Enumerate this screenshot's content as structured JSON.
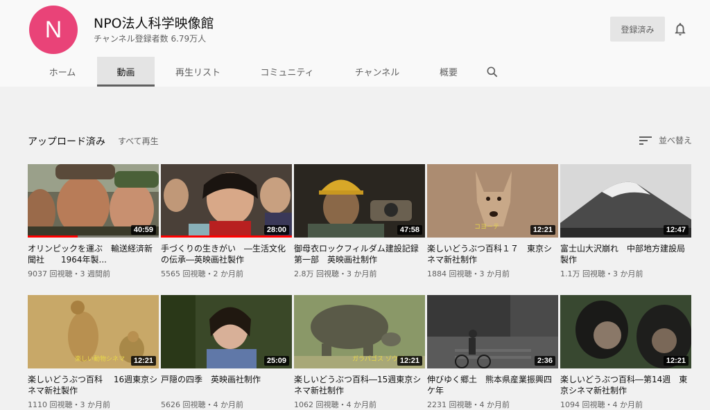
{
  "channel": {
    "avatar_letter": "N",
    "avatar_color": "#e94378",
    "name": "NPO法人科学映像館",
    "subscribers": "チャンネル登録者数 6.79万人",
    "subscribe_label": "登録済み"
  },
  "tabs": [
    {
      "label": "ホーム"
    },
    {
      "label": "動画"
    },
    {
      "label": "再生リスト"
    },
    {
      "label": "コミュニティ"
    },
    {
      "label": "チャンネル"
    },
    {
      "label": "概要"
    }
  ],
  "section": {
    "title": "アップロード済み",
    "play_all": "すべて再生",
    "sort_label": "並べ替え"
  },
  "videos": [
    {
      "title": "オリンピックを運ぶ　輸送経済新聞社　　1964年製...",
      "meta": "9037 回視聴・3 週間前",
      "duration": "40:59",
      "progress": 0.38,
      "thumb_icon": "men-in-caps-thumbnail"
    },
    {
      "title": "手づくりの生きがい　―生活文化の伝承―英映画社製作",
      "meta": "5565 回視聴・2 か月前",
      "duration": "28:00",
      "progress": 1.0,
      "thumb_icon": "smiling-women-thumbnail"
    },
    {
      "title": "御母衣ロックフィルダム建設記録　第一部　英映画社制作",
      "meta": "2.8万 回視聴・3 か月前",
      "duration": "47:58",
      "progress": 0,
      "thumb_icon": "worker-helmet-thumbnail"
    },
    {
      "title": "楽しいどうぶつ百科１７　東京シネマ新社制作",
      "meta": "1884 回視聴・3 か月前",
      "duration": "12:21",
      "progress": 0,
      "caption": "コヨーテ",
      "thumb_icon": "coyote-thumbnail"
    },
    {
      "title": "富士山大沢崩れ　中部地方建設局製作",
      "meta": "1.1万 回視聴・3 か月前",
      "duration": "12:47",
      "progress": 0,
      "thumb_icon": "mount-fuji-thumbnail"
    },
    {
      "title": "楽しいどうぶつ百科　 16週東京シネマ新社製作",
      "meta": "1110 回視聴・3 か月前",
      "duration": "12:21",
      "progress": 0,
      "caption": "楽しい動物シネマ",
      "thumb_icon": "cheetahs-thumbnail"
    },
    {
      "title": "戸隠の四季　英映画社制作",
      "meta": "5626 回視聴・4 か月前",
      "duration": "25:09",
      "progress": 0,
      "thumb_icon": "woman-in-forest-thumbnail"
    },
    {
      "title": "楽しいどうぶつ百科―15週東京シネマ新社制作",
      "meta": "1062 回視聴・4 か月前",
      "duration": "12:21",
      "progress": 0,
      "caption": "ガラパゴス ゾウガメ",
      "thumb_icon": "tortoise-thumbnail"
    },
    {
      "title": "伸びゆく郷土　熊本県産業振興四ケ年",
      "meta": "2231 回視聴・4 か月前",
      "duration": "2:36",
      "progress": 0,
      "thumb_icon": "cyclist-thumbnail"
    },
    {
      "title": "楽しいどうぶつ百科―第14週　東京シネマ新社制作",
      "meta": "1094 回視聴・4 か月前",
      "duration": "12:21",
      "progress": 0,
      "thumb_icon": "chimpanzees-thumbnail"
    }
  ]
}
